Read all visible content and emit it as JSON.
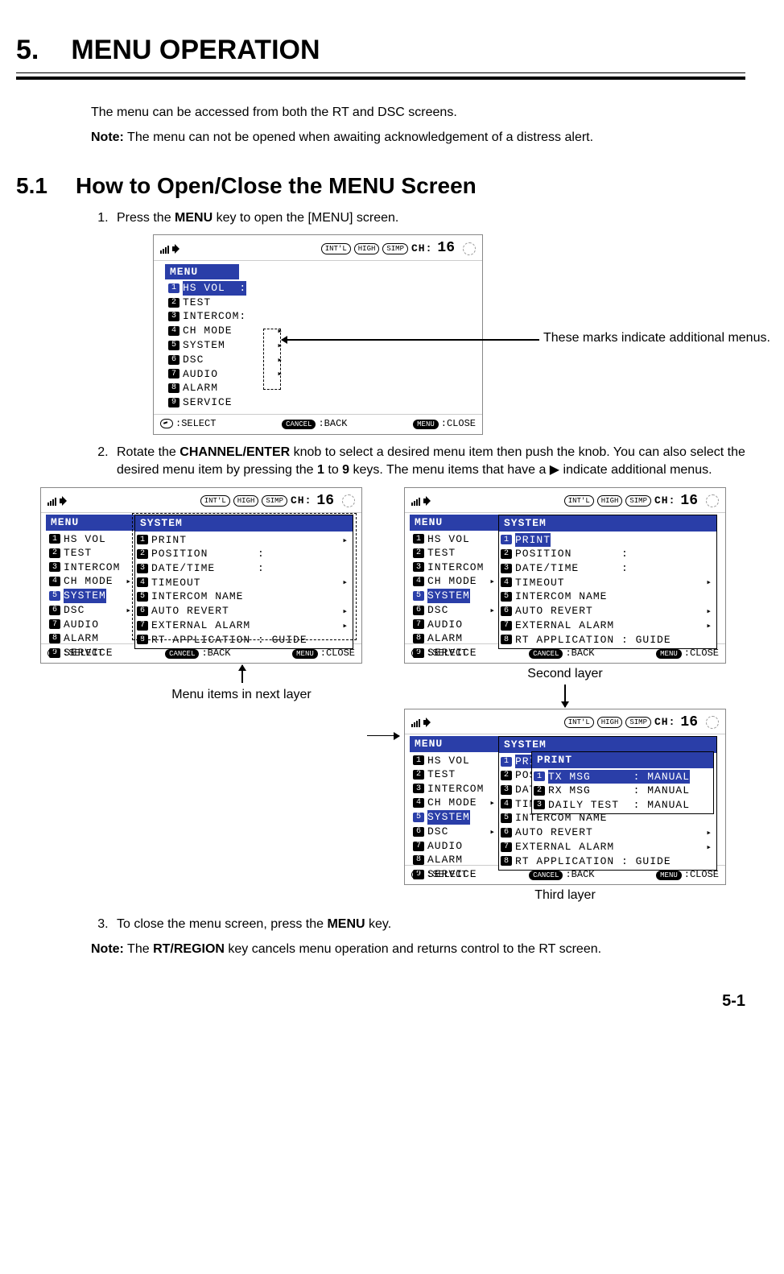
{
  "chapter": {
    "number": "5.",
    "title": "MENU OPERATION"
  },
  "intro1": "The menu can be accessed from both the RT and DSC screens.",
  "intro2_label": "Note:",
  "intro2_text": " The menu can not be opened when awaiting acknowledgement of a distress alert.",
  "sec": {
    "number": "5.1",
    "title": "How to Open/Close the MENU Screen"
  },
  "step1_a": "Press the ",
  "step1_b": "MENU",
  "step1_c": " key to open the [MENU] screen.",
  "main_screen": {
    "badges": [
      "INT'L",
      "HIGH",
      "SIMP"
    ],
    "ch_label": "CH:",
    "ch_num": "16",
    "menu_title": "MENU",
    "items": [
      {
        "n": "1",
        "t": "HS VOL  :",
        "sel": true
      },
      {
        "n": "2",
        "t": "TEST"
      },
      {
        "n": "3",
        "t": "INTERCOM:"
      },
      {
        "n": "4",
        "t": "CH MODE",
        "arrow": true
      },
      {
        "n": "5",
        "t": "SYSTEM",
        "arrow": true
      },
      {
        "n": "6",
        "t": "DSC",
        "arrow": true
      },
      {
        "n": "7",
        "t": "AUDIO",
        "arrow": true
      },
      {
        "n": "8",
        "t": "ALARM"
      },
      {
        "n": "9",
        "t": "SERVICE"
      }
    ],
    "footer": {
      "select": ":SELECT",
      "back": ":BACK",
      "close": ":CLOSE",
      "back_btn": "CANCEL",
      "close_btn": "MENU"
    }
  },
  "callout1": "These marks indicate additional menus.",
  "step2_a": "Rotate the ",
  "step2_b": "CHANNEL/ENTER",
  "step2_c": " knob to select a desired menu item then push the knob. You can also select the desired menu item by pressing the ",
  "step2_d": "1",
  "step2_e": " to ",
  "step2_f": "9",
  "step2_g": " keys. The menu items that have a ▶ indicate additional menus.",
  "left2_caption": "Menu items in next layer",
  "right2_caption": "Second layer",
  "right3_caption": "Third layer",
  "layer_screens": {
    "base_items": [
      {
        "n": "1",
        "t": "HS VOL"
      },
      {
        "n": "2",
        "t": "TEST"
      },
      {
        "n": "3",
        "t": "INTERCOM"
      },
      {
        "n": "4",
        "t": "CH MODE",
        "arrow": true
      },
      {
        "n": "5",
        "t": "SYSTEM",
        "arrow": true,
        "sel": true
      },
      {
        "n": "6",
        "t": "DSC",
        "arrow": true
      },
      {
        "n": "7",
        "t": "AUDIO"
      },
      {
        "n": "8",
        "t": "ALARM"
      },
      {
        "n": "9",
        "t": "SERVICE"
      }
    ],
    "system_title": "SYSTEM",
    "system_items": [
      {
        "n": "1",
        "t": "PRINT",
        "arrow": true
      },
      {
        "n": "2",
        "t": "POSITION       :"
      },
      {
        "n": "3",
        "t": "DATE/TIME      :"
      },
      {
        "n": "4",
        "t": "TIMEOUT",
        "arrow": true
      },
      {
        "n": "5",
        "t": "INTERCOM NAME"
      },
      {
        "n": "6",
        "t": "AUTO REVERT",
        "arrow": true
      },
      {
        "n": "7",
        "t": "EXTERNAL ALARM",
        "arrow": true
      },
      {
        "n": "8",
        "t": "RT APPLICATION : GUIDE"
      }
    ],
    "print_title": "PRINT",
    "print_items": [
      {
        "n": "1",
        "t": "TX MSG      : MANUAL"
      },
      {
        "n": "2",
        "t": "RX MSG      : MANUAL"
      },
      {
        "n": "3",
        "t": "DAILY TEST  : MANUAL"
      }
    ]
  },
  "step3_a": "To close the menu screen, press the ",
  "step3_b": "MENU",
  "step3_c": " key.",
  "note3_label": "Note:",
  "note3_text": " The ",
  "note3_b": "RT/REGION",
  "note3_text2": " key cancels menu operation and returns control to the RT screen.",
  "page_num": "5-1"
}
